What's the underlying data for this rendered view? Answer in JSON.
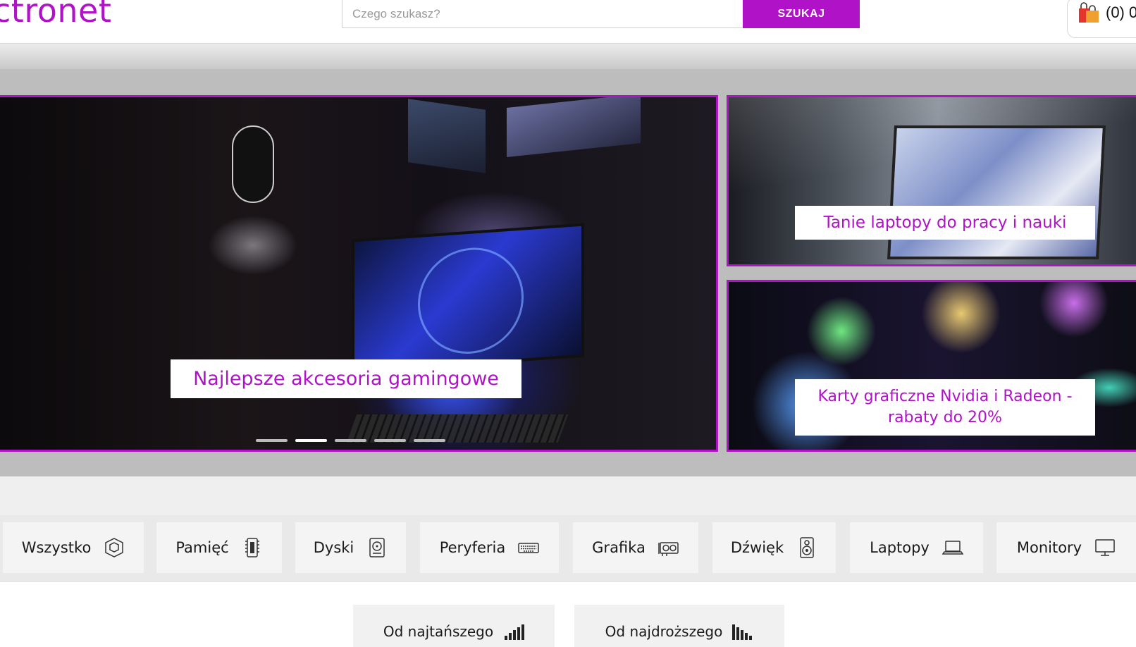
{
  "header": {
    "logo_text": "ctronet",
    "search_placeholder": "Czego szukasz?",
    "search_button": "SZUKAJ",
    "cart_count": "(0) 0"
  },
  "hero": {
    "main_caption": "Najlepsze akcesoria gamingowe",
    "top_right_caption": "Tanie laptopy do pracy i nauki",
    "bottom_right_caption": "Karty graficzne Nvidia i Radeon - rabaty do 20%",
    "slides_total": 5,
    "active_slide": 2
  },
  "categories": [
    {
      "label": "Wszystko",
      "icon": "cube-icon"
    },
    {
      "label": "Pamięć",
      "icon": "memory-chip-icon"
    },
    {
      "label": "Dyski",
      "icon": "hard-disk-icon"
    },
    {
      "label": "Peryferia",
      "icon": "keyboard-icon"
    },
    {
      "label": "Grafika",
      "icon": "graphics-card-icon"
    },
    {
      "label": "Dźwięk",
      "icon": "speaker-icon"
    },
    {
      "label": "Laptopy",
      "icon": "laptop-icon"
    },
    {
      "label": "Monitory",
      "icon": "monitor-icon"
    }
  ],
  "sort": {
    "cheapest": "Od najtańszego",
    "most_expensive": "Od najdroższego"
  },
  "colors": {
    "accent": "#b012c8"
  }
}
